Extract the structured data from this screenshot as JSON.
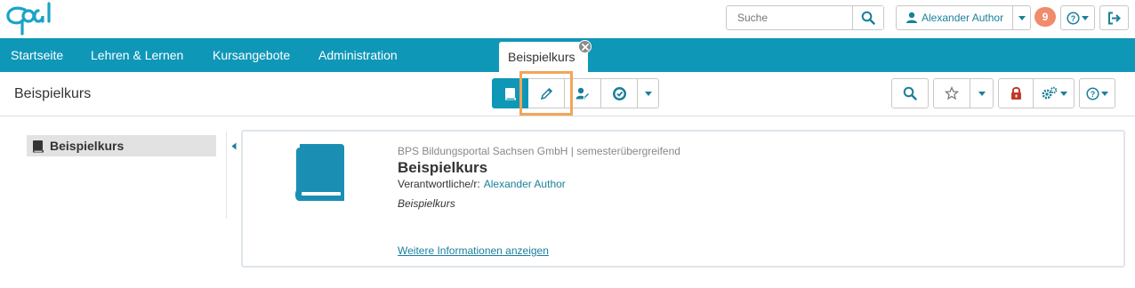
{
  "brand": {
    "logo_text": "Opal",
    "accent": "#0f97b8"
  },
  "search": {
    "placeholder": "Suche",
    "icon": "search-icon"
  },
  "user": {
    "name": "Alexander Author",
    "notification_count": "9"
  },
  "nav": {
    "items": [
      {
        "label": "Startseite"
      },
      {
        "label": "Lehren & Lernen"
      },
      {
        "label": "Kursangebote"
      },
      {
        "label": "Administration"
      }
    ],
    "active_tab": "Beispielkurs"
  },
  "subbar": {
    "title": "Beispielkurs",
    "tools": [
      "book-icon",
      "pencil-icon",
      "user-edit-icon",
      "certificate-icon",
      "caret-icon"
    ],
    "right_tools": [
      "search-icon",
      "star-icon",
      "lock-icon",
      "gears-icon",
      "help-icon"
    ]
  },
  "sidebar": {
    "items": [
      {
        "label": "Beispielkurs"
      }
    ]
  },
  "course": {
    "provider": "BPS Bildungsportal Sachsen GmbH | semesterübergreifend",
    "title": "Beispielkurs",
    "responsible_label": "Verantwortliche/r:",
    "responsible_name": "Alexander Author",
    "description": "Beispielkurs",
    "more_link": "Weitere Informationen anzeigen"
  }
}
